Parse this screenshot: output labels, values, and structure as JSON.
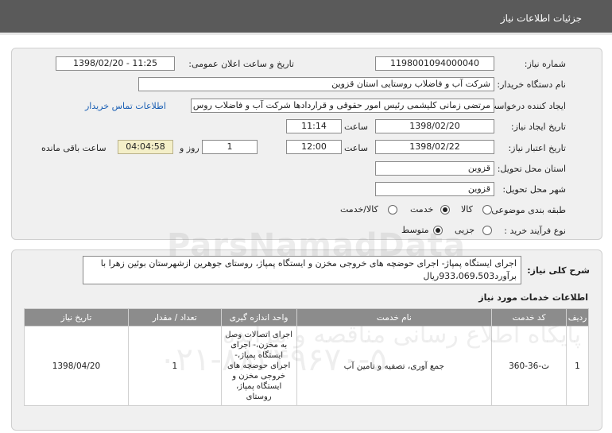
{
  "header": {
    "title": "جزئیات اطلاعات نیاز"
  },
  "form": {
    "need_number": {
      "label": "شماره نیاز:",
      "value": "1198001094000040"
    },
    "announce": {
      "label": "تاریخ و ساعت اعلان عمومی:",
      "value": "1398/02/20 - 11:25"
    },
    "buyer": {
      "label": "نام دستگاه خریدار:",
      "value": "شرکت آب و فاضلاب روستایی استان قزوین"
    },
    "creator": {
      "label": "ایجاد کننده درخواست:",
      "value": "مرتضی زمانی کلیشمی رئیس امور حقوقی و قراردادها شرکت آب و فاضلاب روس",
      "contact_link": "اطلاعات تماس خریدار"
    },
    "created": {
      "label": "تاریخ ایجاد نیاز:",
      "date": "1398/02/20",
      "time_label": "ساعت",
      "time": "11:14"
    },
    "validity": {
      "label": "تاریخ اعتبار نیاز:",
      "date": "1398/02/22",
      "time_label": "ساعت",
      "time": "12:00",
      "days": "1",
      "days_label": "روز و",
      "remaining": "04:04:58",
      "remaining_label": "ساعت باقی مانده"
    },
    "province": {
      "label": "استان محل تحویل:",
      "value": "قزوین"
    },
    "city": {
      "label": "شهر محل تحویل:",
      "value": "قزوین"
    },
    "category": {
      "label": "طبقه بندی موضوعی:",
      "options": [
        "کالا",
        "خدمت",
        "کالا/خدمت"
      ],
      "selected": "خدمت"
    },
    "process": {
      "label": "نوع فرآیند خرید :",
      "options": [
        "جزیی",
        "متوسط"
      ],
      "selected": "متوسط"
    }
  },
  "summary": {
    "label": "شرح کلی نیاز:",
    "text": "اجرای ایستگاه پمپاژ- اجرای حوضچه های خروجی مخزن و ایستگاه پمپاژ، روستای جوهرین ازشهرستان بوئین زهرا با برآورد933،069،503ریال"
  },
  "services": {
    "title": "اطلاعات خدمات مورد نیاز",
    "columns": [
      "ردیف",
      "کد خدمت",
      "نام خدمت",
      "واحد اندازه گیری",
      "تعداد / مقدار",
      "تاریخ نیاز"
    ],
    "rows": [
      {
        "row": "1",
        "code": "ث-36-360",
        "name": "جمع آوری، تصفیه و تامین آب",
        "unit": "اجرای اتصالات وصل به مخزن،- اجرای ایستگاه پمپاژ،- اجرای حوضچه های خروجی مخزن و ایستگاه پمپاژ، روستای",
        "qty": "1",
        "date": "1398/04/20"
      }
    ]
  },
  "watermark": {
    "brand": "ParsNamadData",
    "line1": "پایگاه اطلاع رسانی مناقصه و مزایده",
    "phone": "۰۲۱-۸۸۳۴۹۶۷۰-۵"
  }
}
